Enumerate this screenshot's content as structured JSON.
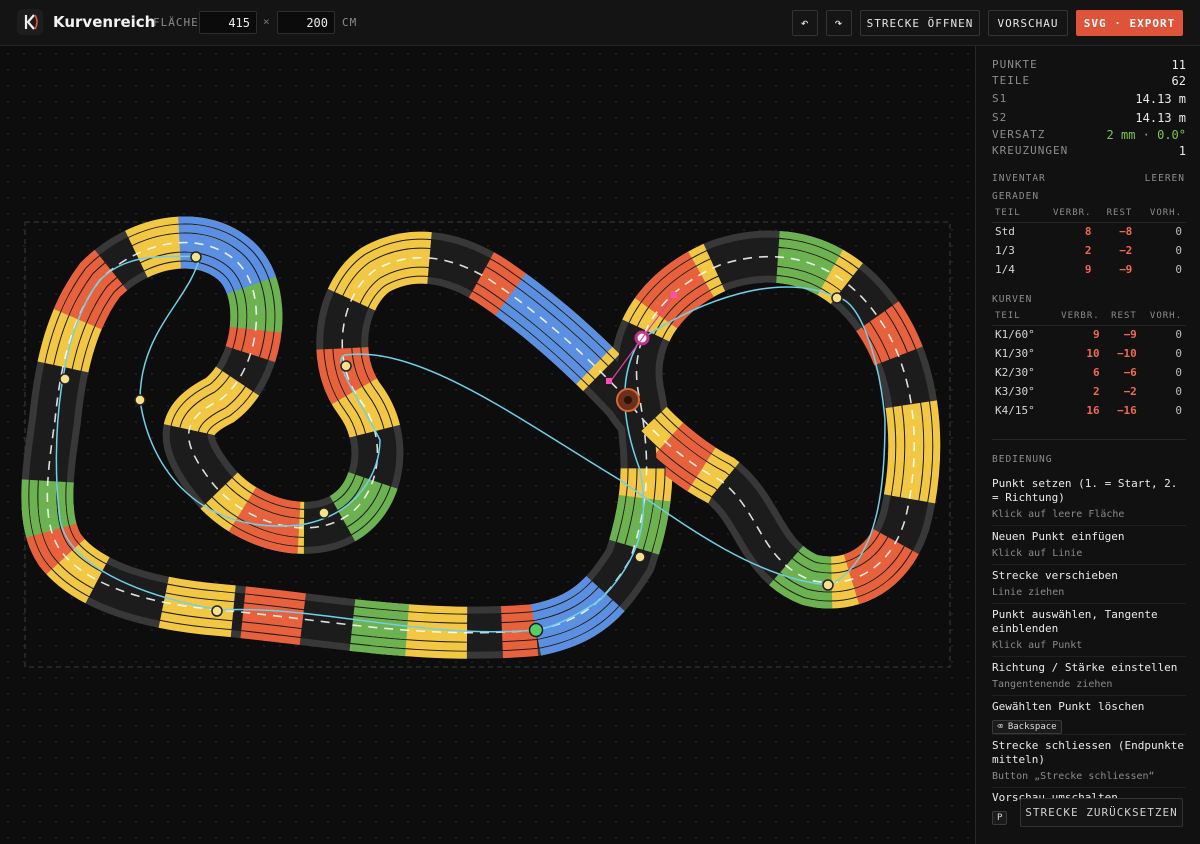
{
  "app": {
    "title": "Kurvenreich",
    "logo_icon": "logo-k-icon"
  },
  "header": {
    "area_label": "FLÄCHE",
    "width_value": "415",
    "height_value": "200",
    "times": "×",
    "unit": "CM",
    "undo_icon": "↶",
    "redo_icon": "↷",
    "open_label": "STRECKE ÖFFNEN",
    "preview_label": "VORSCHAU",
    "export_label": "SVG · EXPORT"
  },
  "colors": {
    "accent": "#e0533b",
    "yellow": "#f2c744",
    "orange": "#e8613d",
    "green": "#6cb250",
    "blue": "#5b8fe2",
    "asphalt": "#383838",
    "guide": "#6ed0ea"
  },
  "stats": {
    "points_label": "PUNKTE",
    "points": "11",
    "parts_label": "TEILE",
    "parts": "62",
    "s1_label": "S1",
    "s1": "14.13 m",
    "s2_label": "S2",
    "s2": "14.13 m",
    "offset_label": "VERSATZ",
    "offset": "2 mm · 0.0°",
    "crossings_label": "KREUZUNGEN",
    "crossings": "1"
  },
  "inventory": {
    "title": "INVENTAR",
    "clear": "LEEREN",
    "straights_title": "GERADEN",
    "curves_title": "KURVEN",
    "columns": [
      "TEIL",
      "VERBR.",
      "REST",
      "VORH."
    ],
    "straights": [
      {
        "part": "Std",
        "used": "8",
        "rest": "−8",
        "avail": "0"
      },
      {
        "part": "1/3",
        "used": "2",
        "rest": "−2",
        "avail": "0"
      },
      {
        "part": "1/4",
        "used": "9",
        "rest": "−9",
        "avail": "0"
      }
    ],
    "curves": [
      {
        "part": "K1/60°",
        "used": "9",
        "rest": "−9",
        "avail": "0"
      },
      {
        "part": "K1/30°",
        "used": "10",
        "rest": "−10",
        "avail": "0"
      },
      {
        "part": "K2/30°",
        "used": "6",
        "rest": "−6",
        "avail": "0"
      },
      {
        "part": "K3/30°",
        "used": "2",
        "rest": "−2",
        "avail": "0"
      },
      {
        "part": "K4/15°",
        "used": "16",
        "rest": "−16",
        "avail": "0"
      }
    ]
  },
  "controls": {
    "title": "BEDIENUNG",
    "items": [
      {
        "title": "Punkt setzen (1. = Start, 2. = Richtung)",
        "desc": "Klick auf leere Fläche"
      },
      {
        "title": "Neuen Punkt einfügen",
        "desc": "Klick auf Linie"
      },
      {
        "title": "Strecke verschieben",
        "desc": "Linie ziehen"
      },
      {
        "title": "Punkt auswählen, Tangente einblenden",
        "desc": "Klick auf Punkt"
      },
      {
        "title": "Richtung / Stärke einstellen",
        "desc": "Tangentenende ziehen"
      },
      {
        "title": "Gewählten Punkt löschen",
        "key": "⌫ Backspace"
      },
      {
        "title": "Strecke schliessen (Endpunkte mitteln)",
        "desc": "Button „Strecke schliessen“"
      },
      {
        "title": "Vorschau umschalten",
        "key": "P"
      }
    ]
  },
  "reset_label": "STRECKE ZURÜCKSETZEN"
}
